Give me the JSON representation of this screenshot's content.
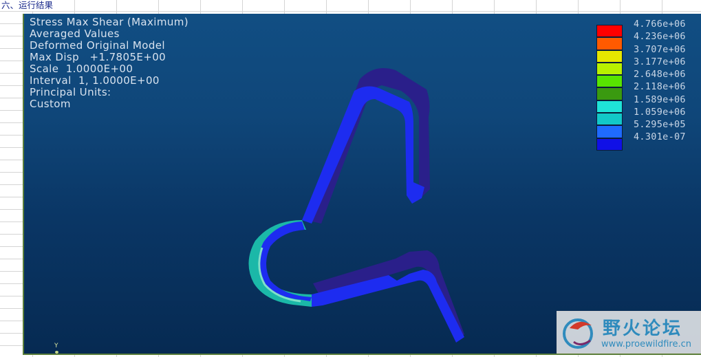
{
  "sheet": {
    "heading": "六、运行结果"
  },
  "result": {
    "lines": [
      "Stress Max Shear (Maximum)",
      "Averaged Values",
      "Deformed Original Model",
      "Max Disp   +1.7805E+00",
      "Scale  1.0000E+00",
      "Interval  1, 1.0000E+00",
      "Principal Units:",
      "Custom"
    ]
  },
  "legend": {
    "labels": [
      "4.766e+06",
      "4.236e+06",
      "3.707e+06",
      "3.177e+06",
      "2.648e+06",
      "2.118e+06",
      "1.589e+06",
      "1.059e+06",
      "5.295e+05",
      "4.301e-07"
    ],
    "colors": [
      "#ff0000",
      "#ff5a00",
      "#e6e600",
      "#b8f000",
      "#58e400",
      "#3a9a10",
      "#1fe3d8",
      "#12c8c8",
      "#1f6aff",
      "#1010e6"
    ]
  },
  "axis": {
    "y_label": "Y"
  },
  "watermark": {
    "title": "野火论坛",
    "url": "www.proewildfire.cn"
  }
}
